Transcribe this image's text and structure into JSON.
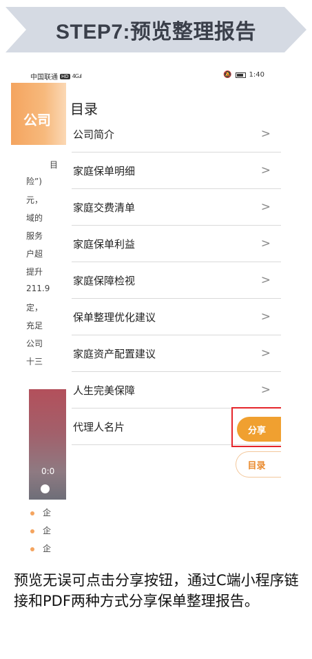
{
  "banner": {
    "title": "STEP7:预览整理报告"
  },
  "status": {
    "carrier": "中国联通",
    "net": "HD",
    "signal": "4G",
    "time": "1:40"
  },
  "background_page": {
    "header_text": "公司",
    "lines": [
      "目",
      "险”)",
      "元，",
      "域的",
      "服务",
      "户超",
      "提升",
      "211.9",
      "定，",
      "充足",
      "公司",
      "十三"
    ],
    "video_time": "0:0",
    "bullets": [
      "企",
      "企",
      "企"
    ]
  },
  "drawer": {
    "title": "目录",
    "items": [
      {
        "label": "公司简介"
      },
      {
        "label": "家庭保单明细"
      },
      {
        "label": "家庭交费清单"
      },
      {
        "label": "家庭保单利益"
      },
      {
        "label": "家庭保障检视"
      },
      {
        "label": "保单整理优化建议"
      },
      {
        "label": "家庭资产配置建议"
      },
      {
        "label": "人生完美保障"
      },
      {
        "label": "代理人名片"
      }
    ],
    "chevron": ">"
  },
  "buttons": {
    "share": "分享",
    "toc": "目录"
  },
  "caption": "预览无误可点击分享按钮，通过C端小程序链接和PDF两种方式分享保单整理报告。",
  "colors": {
    "accent": "#f0a030",
    "highlight": "#e5252b",
    "banner": "#d5dae3"
  }
}
